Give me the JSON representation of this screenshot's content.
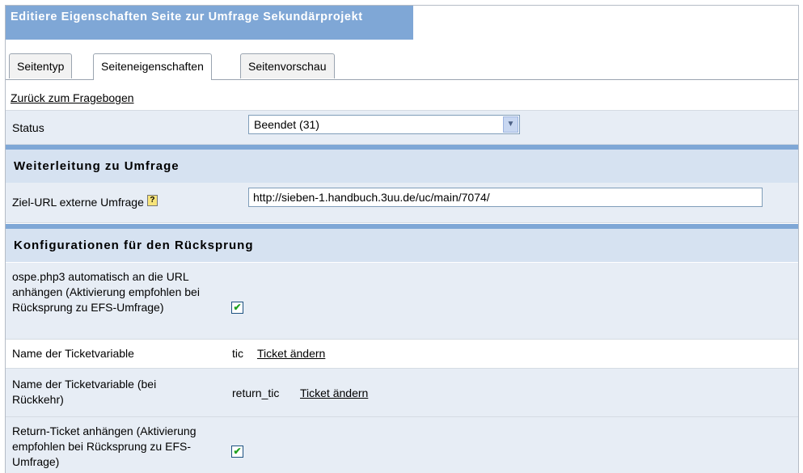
{
  "header": {
    "title": "Editiere Eigenschaften Seite zur Umfrage Sekundärprojekt"
  },
  "tabs": [
    {
      "label": "Seitentyp"
    },
    {
      "label": "Seiteneigenschaften",
      "active": true
    },
    {
      "label": "Seitenvorschau"
    }
  ],
  "back_link": "Zurück zum Fragebogen",
  "status": {
    "label": "Status",
    "selected": "Beendet (31)"
  },
  "section_redirect": {
    "title": "Weiterleitung zu Umfrage",
    "target_url_label": "Ziel-URL externe Umfrage",
    "target_url_value": "http://sieben-1.handbuch.3uu.de/uc/main/7074/",
    "help_icon": "?"
  },
  "section_return": {
    "title": "Konfigurationen für den Rücksprung",
    "append_ospe_label": "ospe.php3 automatisch an die URL anhängen (Aktivierung empfohlen bei Rücksprung zu EFS-Umfrage)",
    "append_ospe_checked": true,
    "ticket_var_label": "Name der Ticketvariable",
    "ticket_var_value": "tic",
    "ticket_change_link": "Ticket ändern",
    "ticket_return_label": "Name der Ticketvariable (bei Rückkehr)",
    "ticket_return_value": "return_tic",
    "ticket_return_change_link": "Ticket ändern",
    "return_ticket_label": "Return-Ticket anhängen (Aktivierung empfohlen bei Rücksprung zu EFS-Umfrage)",
    "return_ticket_checked": true
  },
  "colors": {
    "accent": "#7fa7d6",
    "row_shade": "#e7edf5",
    "section_bg": "#d6e2f1",
    "checkmark": "#21a121"
  }
}
